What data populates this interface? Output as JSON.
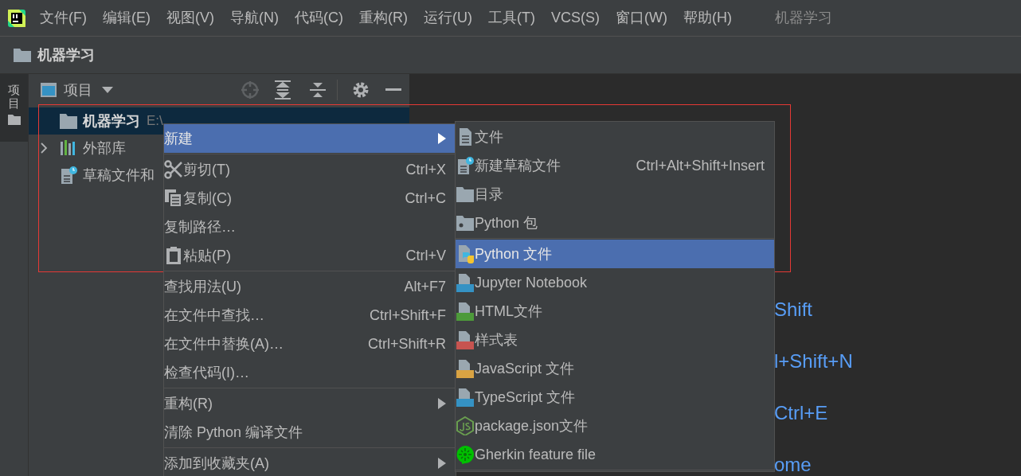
{
  "menu_bar": {
    "items": [
      "文件(F)",
      "编辑(E)",
      "视图(V)",
      "导航(N)",
      "代码(C)",
      "重构(R)",
      "运行(U)",
      "工具(T)",
      "VCS(S)",
      "窗口(W)",
      "帮助(H)"
    ],
    "project_title": "机器学习"
  },
  "breadcrumb": "机器学习",
  "side_tab": {
    "label": "项目",
    "selected": true
  },
  "project_panel": {
    "title": "项目",
    "tree": [
      {
        "kind": "folder",
        "label": "机器学习",
        "path": "E:\\",
        "selected": true
      },
      {
        "kind": "library",
        "label": "外部库",
        "selected": false,
        "expanded": false
      },
      {
        "kind": "scratch",
        "label": "草稿文件和",
        "selected": false
      }
    ]
  },
  "editor_hints": [
    "Shift",
    "l+Shift+N",
    "Ctrl+E",
    "ome"
  ],
  "context_menu": [
    {
      "kind": "plain",
      "label": "新建",
      "selected": true,
      "submenu": true
    },
    {
      "kind": "separator"
    },
    {
      "kind": "scissors",
      "label": "剪切(T)",
      "shortcut": "Ctrl+X",
      "selected": false,
      "submenu": false
    },
    {
      "kind": "copy",
      "label": "复制(C)",
      "shortcut": "Ctrl+C",
      "selected": false,
      "submenu": false
    },
    {
      "kind": "plain",
      "label": "复制路径…",
      "selected": false,
      "submenu": false
    },
    {
      "kind": "paste",
      "label": "粘贴(P)",
      "shortcut": "Ctrl+V",
      "selected": false,
      "submenu": false
    },
    {
      "kind": "separator"
    },
    {
      "kind": "plain",
      "label": "查找用法(U)",
      "shortcut": "Alt+F7",
      "selected": false,
      "submenu": false
    },
    {
      "kind": "plain",
      "label": "在文件中查找…",
      "shortcut": "Ctrl+Shift+F",
      "selected": false,
      "submenu": false
    },
    {
      "kind": "plain",
      "label": "在文件中替换(A)…",
      "shortcut": "Ctrl+Shift+R",
      "selected": false,
      "submenu": false
    },
    {
      "kind": "plain",
      "label": "检查代码(I)…",
      "selected": false,
      "submenu": false
    },
    {
      "kind": "separator"
    },
    {
      "kind": "plain",
      "label": "重构(R)",
      "selected": false,
      "submenu": true
    },
    {
      "kind": "plain",
      "label": "清除 Python 编译文件",
      "selected": false,
      "submenu": false
    },
    {
      "kind": "separator"
    },
    {
      "kind": "plain",
      "label": "添加到收藏夹(A)",
      "selected": false,
      "submenu": true
    }
  ],
  "new_submenu": [
    {
      "kind": "file",
      "label": "文件",
      "selected": false
    },
    {
      "kind": "scratch",
      "label": "新建草稿文件",
      "shortcut": "Ctrl+Alt+Shift+Insert",
      "selected": false
    },
    {
      "kind": "folder",
      "label": "目录",
      "selected": false
    },
    {
      "kind": "package",
      "label": "Python 包",
      "selected": false
    },
    {
      "kind": "separator"
    },
    {
      "kind": "python",
      "label": "Python 文件",
      "selected": true
    },
    {
      "kind": "jupyter",
      "label": "Jupyter Notebook",
      "selected": false
    },
    {
      "kind": "html",
      "label": "HTML文件",
      "selected": false
    },
    {
      "kind": "css",
      "label": "样式表",
      "selected": false
    },
    {
      "kind": "js",
      "label": "JavaScript 文件",
      "selected": false
    },
    {
      "kind": "ts",
      "label": "TypeScript 文件",
      "selected": false
    },
    {
      "kind": "nodejs",
      "label": "package.json文件",
      "selected": false
    },
    {
      "kind": "gherkin",
      "label": "Gherkin feature file",
      "selected": false
    },
    {
      "kind": "separator"
    }
  ]
}
